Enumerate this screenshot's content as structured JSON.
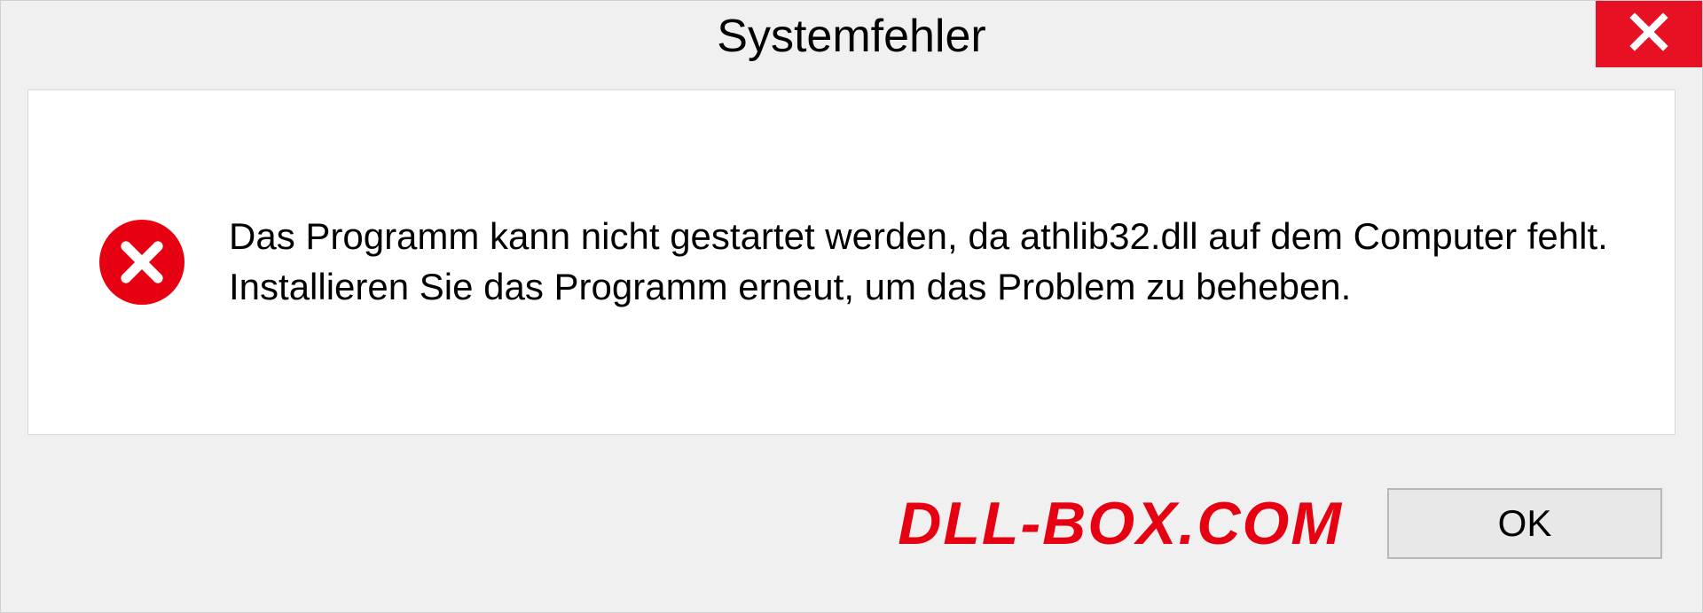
{
  "dialog": {
    "title": "Systemfehler",
    "message": "Das Programm kann nicht gestartet werden, da athlib32.dll auf dem Computer fehlt. Installieren Sie das Programm erneut, um das Problem zu beheben.",
    "ok_label": "OK",
    "watermark": "DLL-BOX.COM"
  }
}
